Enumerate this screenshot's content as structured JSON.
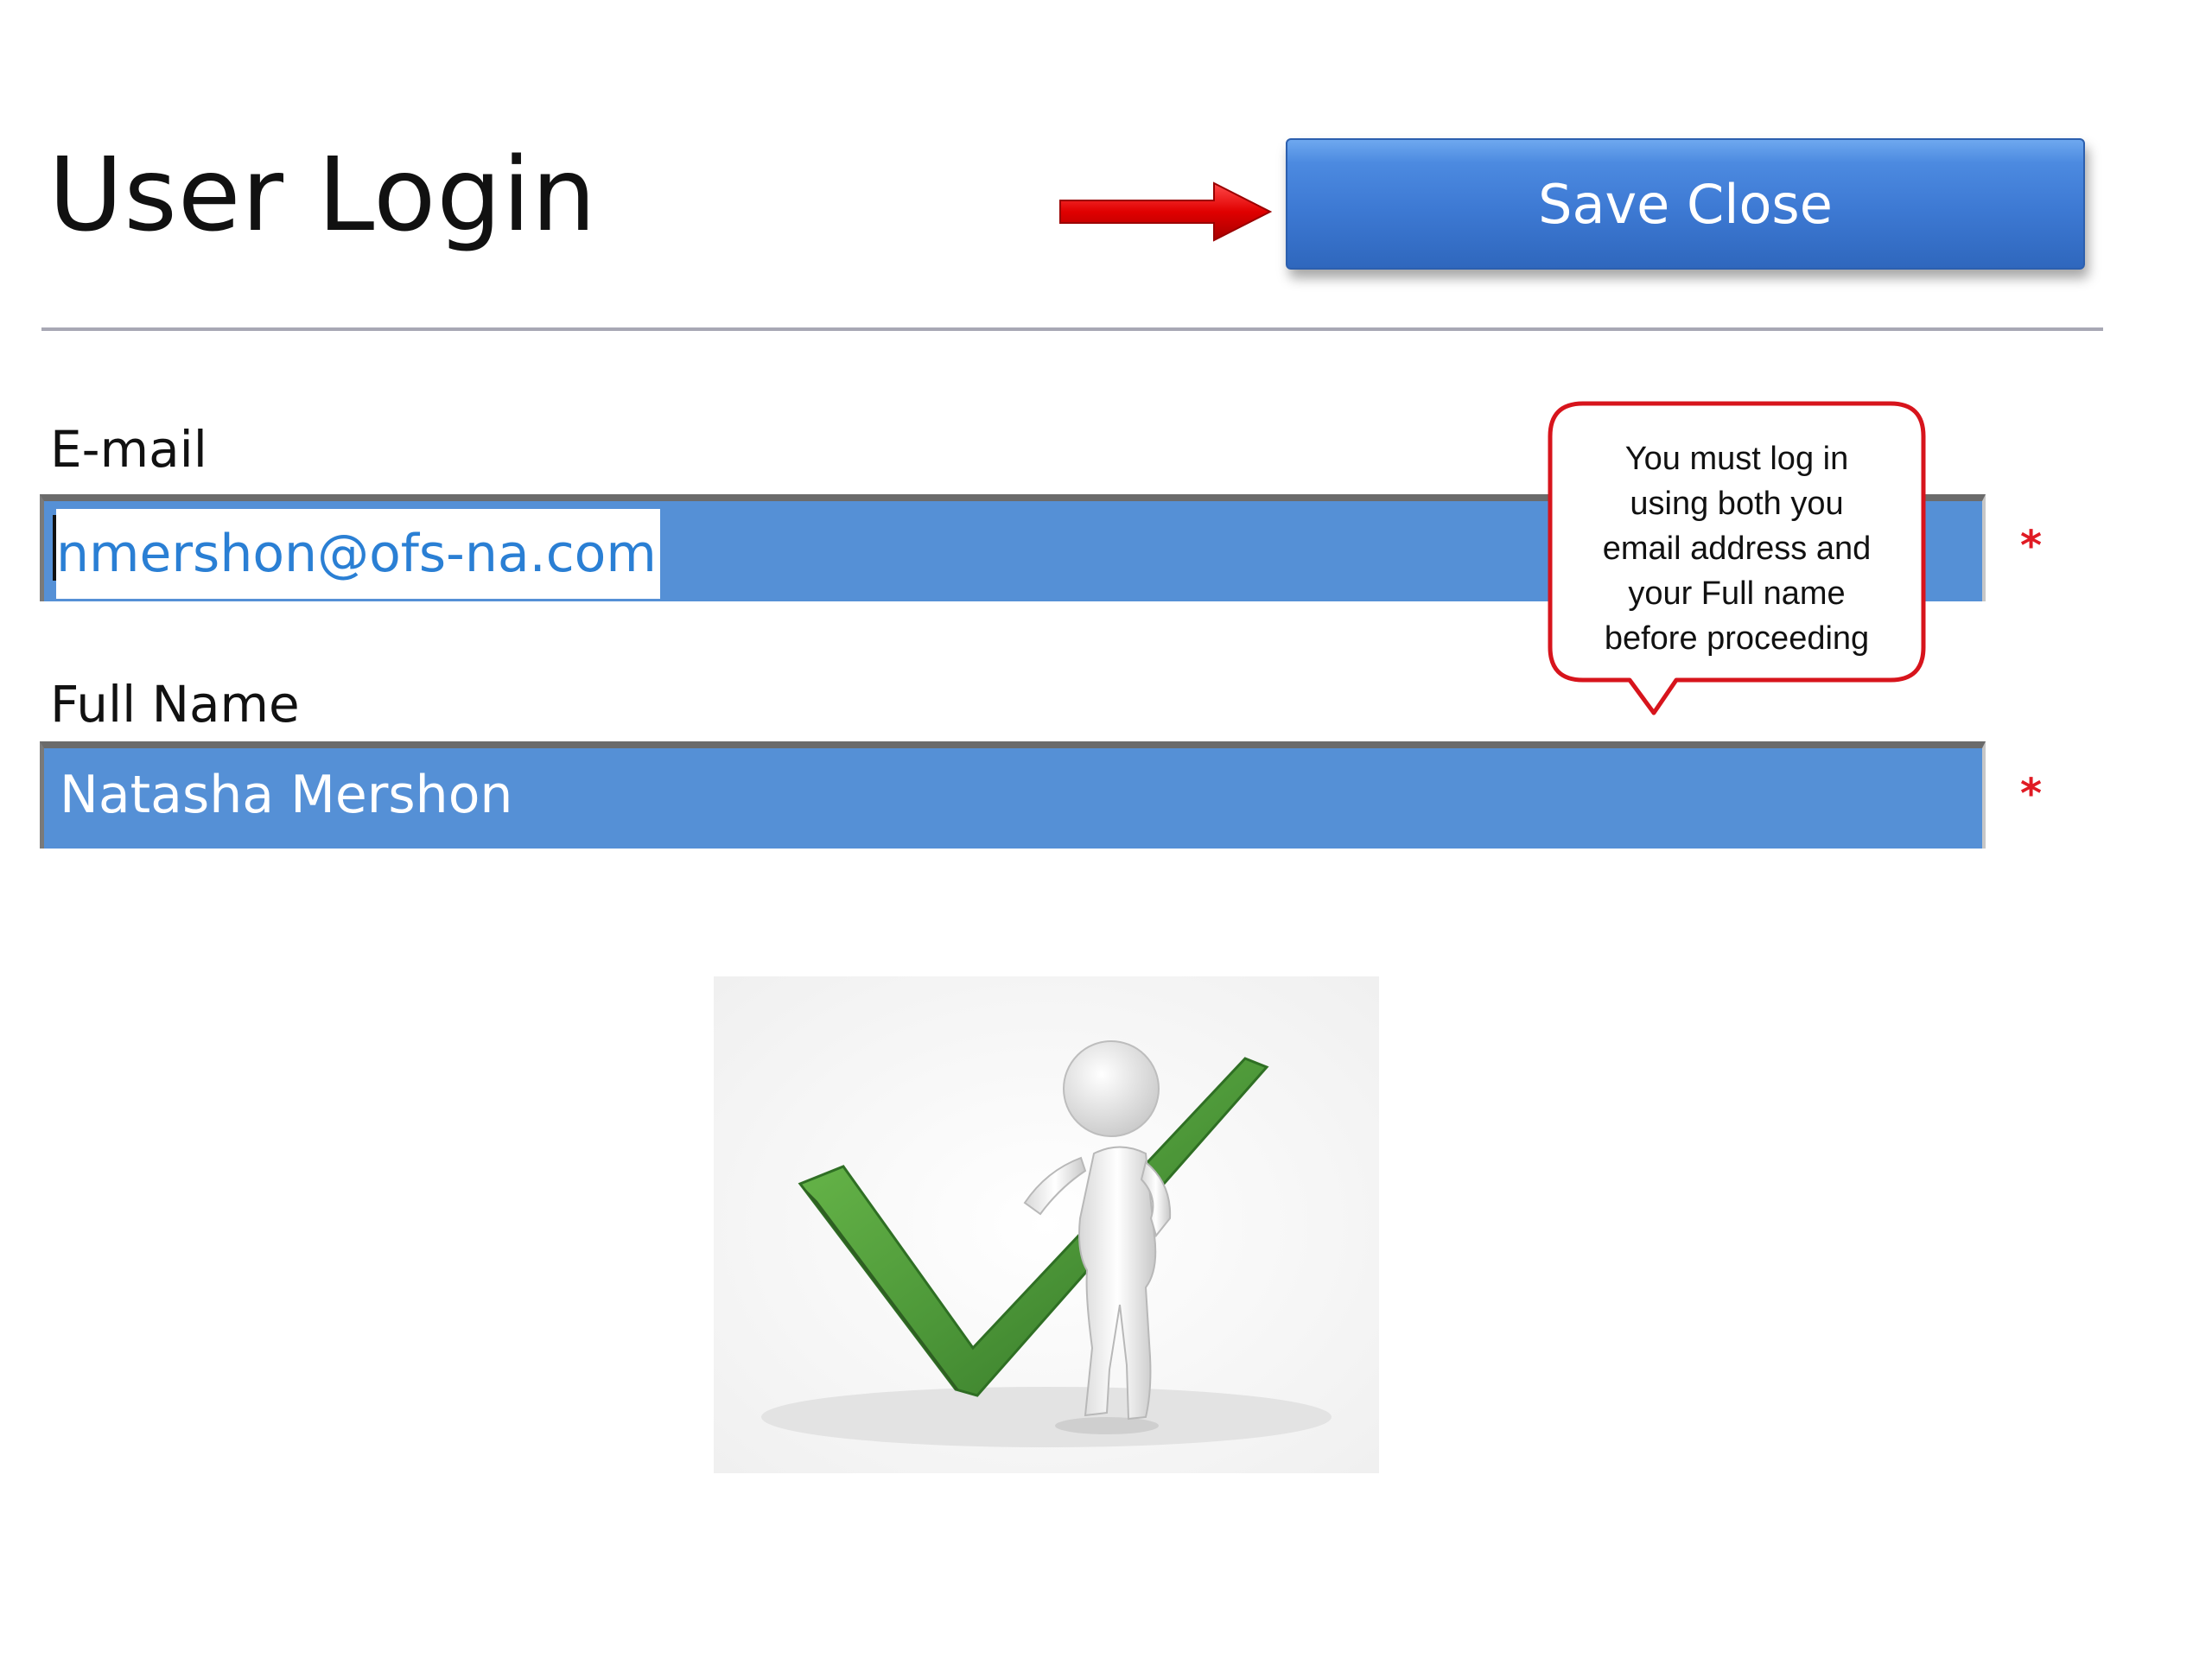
{
  "header": {
    "title": "User Login",
    "save_close_label": "Save Close",
    "arrow_icon": "red-right-arrow"
  },
  "form": {
    "email": {
      "label": "E-mail",
      "value": "nmershon@ofs-na.com",
      "required_marker": "*"
    },
    "full_name": {
      "label": "Full Name",
      "value": "Natasha Mershon",
      "required_marker": "*"
    }
  },
  "callout": {
    "lines": [
      "You must log in",
      "using both you",
      "email address and",
      "your Full name",
      "before proceeding"
    ]
  },
  "illustration": {
    "icon": "stick-figure-with-green-checkmark"
  },
  "colors": {
    "button_blue": "#3d79d3",
    "field_blue": "#5590d6",
    "required_red": "#e01b24",
    "callout_border": "#d7141c",
    "check_green": "#4f9a3a"
  }
}
